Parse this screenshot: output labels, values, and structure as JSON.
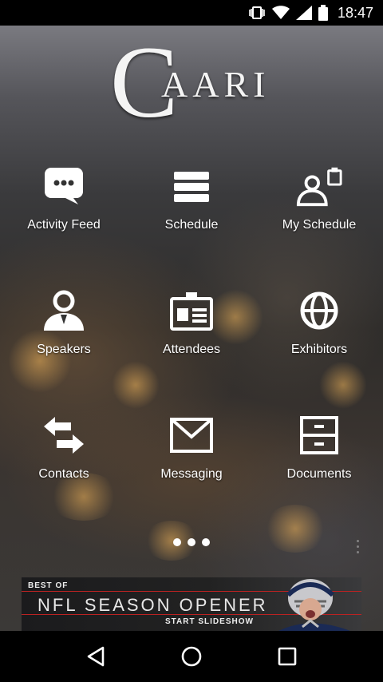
{
  "status_bar": {
    "time": "18:47"
  },
  "logo": {
    "initial": "C",
    "rest": "AARI"
  },
  "menu": [
    {
      "label": "Activity Feed",
      "icon": "chat-bubble-icon"
    },
    {
      "label": "Schedule",
      "icon": "list-icon"
    },
    {
      "label": "My Schedule",
      "icon": "user-clipboard-icon"
    },
    {
      "label": "Speakers",
      "icon": "speaker-user-icon"
    },
    {
      "label": "Attendees",
      "icon": "id-badge-icon"
    },
    {
      "label": "Exhibitors",
      "icon": "globe-icon"
    },
    {
      "label": "Contacts",
      "icon": "swap-arrows-icon"
    },
    {
      "label": "Messaging",
      "icon": "envelope-icon"
    },
    {
      "label": "Documents",
      "icon": "file-cabinet-icon"
    }
  ],
  "banner": {
    "top": "BEST OF",
    "title": "NFL SEASON OPENER",
    "cta": "START SLIDESHOW"
  },
  "colors": {
    "accent_red": "#b22222",
    "background": "#000000"
  }
}
